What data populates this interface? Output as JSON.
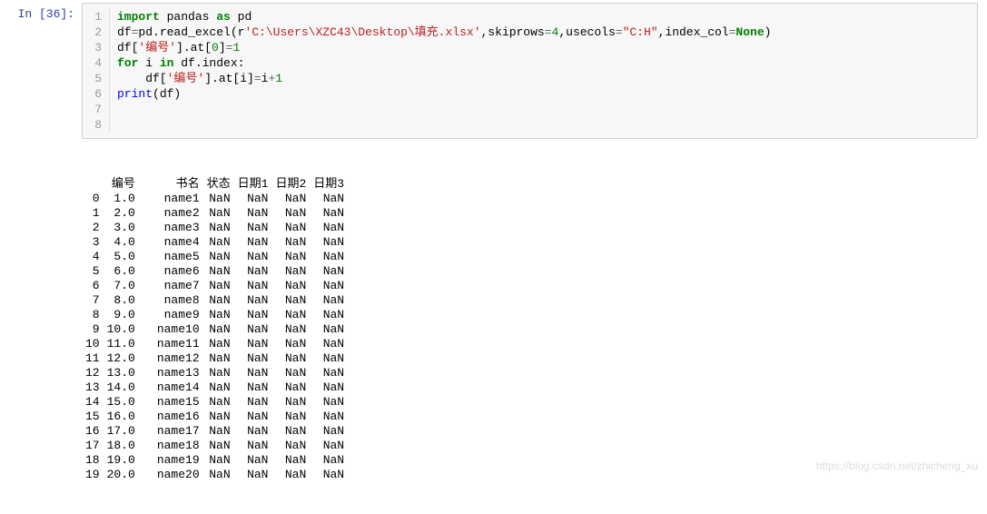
{
  "prompt": "In [36]:",
  "gutter": [
    "1",
    "2",
    "3",
    "4",
    "5",
    "6",
    "7",
    "8"
  ],
  "code": {
    "l1": {
      "t1": "import",
      "t2": " pandas ",
      "t3": "as",
      "t4": " pd"
    },
    "l2": "",
    "l3": {
      "t1": "df",
      "t2": "=",
      "t3": "pd.read_excel(",
      "t4": "r",
      "t5": "'C:\\Users\\XZC43\\Desktop\\填充.xlsx'",
      "t6": ",skiprows",
      "t7": "=",
      "t8": "4",
      "t9": ",usecols",
      "t10": "=",
      "t11": "\"C:H\"",
      "t12": ",index_col",
      "t13": "=",
      "t14": "None",
      "t15": ")"
    },
    "l4": "",
    "l5": {
      "t1": "df[",
      "t2": "'编号'",
      "t3": "].at[",
      "t4": "0",
      "t5": "]",
      "t6": "=",
      "t7": "1"
    },
    "l6": {
      "t1": "for",
      "t2": " i ",
      "t3": "in",
      "t4": " df.index:"
    },
    "l7": {
      "t1": "    df[",
      "t2": "'编号'",
      "t3": "].at[i]",
      "t4": "=",
      "t5": "i",
      "t6": "+",
      "t7": "1"
    },
    "l8": {
      "t1": "print",
      "t2": "(df)"
    }
  },
  "output": {
    "columns": [
      "",
      "编号",
      "书名",
      "状态",
      "日期1",
      "日期2",
      "日期3"
    ],
    "rows": [
      [
        "0",
        "1.0",
        "name1",
        "NaN",
        "NaN",
        "NaN",
        "NaN"
      ],
      [
        "1",
        "2.0",
        "name2",
        "NaN",
        "NaN",
        "NaN",
        "NaN"
      ],
      [
        "2",
        "3.0",
        "name3",
        "NaN",
        "NaN",
        "NaN",
        "NaN"
      ],
      [
        "3",
        "4.0",
        "name4",
        "NaN",
        "NaN",
        "NaN",
        "NaN"
      ],
      [
        "4",
        "5.0",
        "name5",
        "NaN",
        "NaN",
        "NaN",
        "NaN"
      ],
      [
        "5",
        "6.0",
        "name6",
        "NaN",
        "NaN",
        "NaN",
        "NaN"
      ],
      [
        "6",
        "7.0",
        "name7",
        "NaN",
        "NaN",
        "NaN",
        "NaN"
      ],
      [
        "7",
        "8.0",
        "name8",
        "NaN",
        "NaN",
        "NaN",
        "NaN"
      ],
      [
        "8",
        "9.0",
        "name9",
        "NaN",
        "NaN",
        "NaN",
        "NaN"
      ],
      [
        "9",
        "10.0",
        "name10",
        "NaN",
        "NaN",
        "NaN",
        "NaN"
      ],
      [
        "10",
        "11.0",
        "name11",
        "NaN",
        "NaN",
        "NaN",
        "NaN"
      ],
      [
        "11",
        "12.0",
        "name12",
        "NaN",
        "NaN",
        "NaN",
        "NaN"
      ],
      [
        "12",
        "13.0",
        "name13",
        "NaN",
        "NaN",
        "NaN",
        "NaN"
      ],
      [
        "13",
        "14.0",
        "name14",
        "NaN",
        "NaN",
        "NaN",
        "NaN"
      ],
      [
        "14",
        "15.0",
        "name15",
        "NaN",
        "NaN",
        "NaN",
        "NaN"
      ],
      [
        "15",
        "16.0",
        "name16",
        "NaN",
        "NaN",
        "NaN",
        "NaN"
      ],
      [
        "16",
        "17.0",
        "name17",
        "NaN",
        "NaN",
        "NaN",
        "NaN"
      ],
      [
        "17",
        "18.0",
        "name18",
        "NaN",
        "NaN",
        "NaN",
        "NaN"
      ],
      [
        "18",
        "19.0",
        "name19",
        "NaN",
        "NaN",
        "NaN",
        "NaN"
      ],
      [
        "19",
        "20.0",
        "name20",
        "NaN",
        "NaN",
        "NaN",
        "NaN"
      ]
    ]
  },
  "watermark": "https://blog.csdn.net/zhicheng_xu"
}
